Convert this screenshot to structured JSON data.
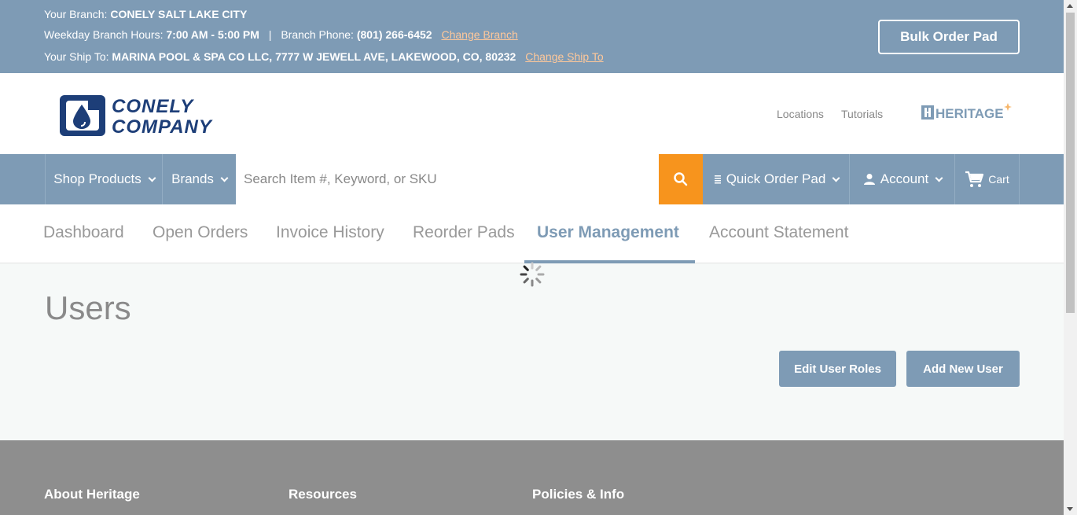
{
  "topbar": {
    "branch_prefix": "Your Branch:",
    "branch_name": "CONELY SALT LAKE CITY",
    "hours_prefix": "Weekday Branch Hours:",
    "hours": "7:00 AM - 5:00 PM",
    "separator": "|",
    "phone_prefix": "Branch Phone:",
    "phone": "(801) 266-6452",
    "change_branch": "Change Branch",
    "ship_prefix": "Your Ship To:",
    "ship_address": "MARINA POOL & SPA CO LLC, 7777 W JEWELL AVE, LAKEWOOD, CO, 80232",
    "change_ship": "Change Ship To",
    "bulk_order": "Bulk Order Pad"
  },
  "header": {
    "logo_line1": "CONELY",
    "logo_line2": "COMPANY",
    "links": [
      "Locations",
      "Tutorials"
    ],
    "heritage_logo": "HERITAGE"
  },
  "nav": {
    "shop_products": "Shop Products",
    "brands": "Brands",
    "search_placeholder": "Search Item #, Keyword, or SKU",
    "quick_order": "Quick Order Pad",
    "account": "Account",
    "cart": "Cart"
  },
  "tabs": [
    {
      "label": "Dashboard",
      "active": false
    },
    {
      "label": "Open Orders",
      "active": false
    },
    {
      "label": "Invoice History",
      "active": false
    },
    {
      "label": "Reorder Pads",
      "active": false
    },
    {
      "label": "User Management",
      "active": true
    },
    {
      "label": "Account Statement",
      "active": false
    }
  ],
  "main": {
    "title": "Users",
    "edit_roles": "Edit User Roles",
    "add_user": "Add New User"
  },
  "footer": {
    "columns": [
      "About Heritage",
      "Resources",
      "Policies & Info"
    ]
  },
  "colors": {
    "brand_blue": "#7e9bb5",
    "accent_orange": "#f7941d",
    "logo_navy": "#1d3e78",
    "footer_gray": "#8e8e8e"
  }
}
